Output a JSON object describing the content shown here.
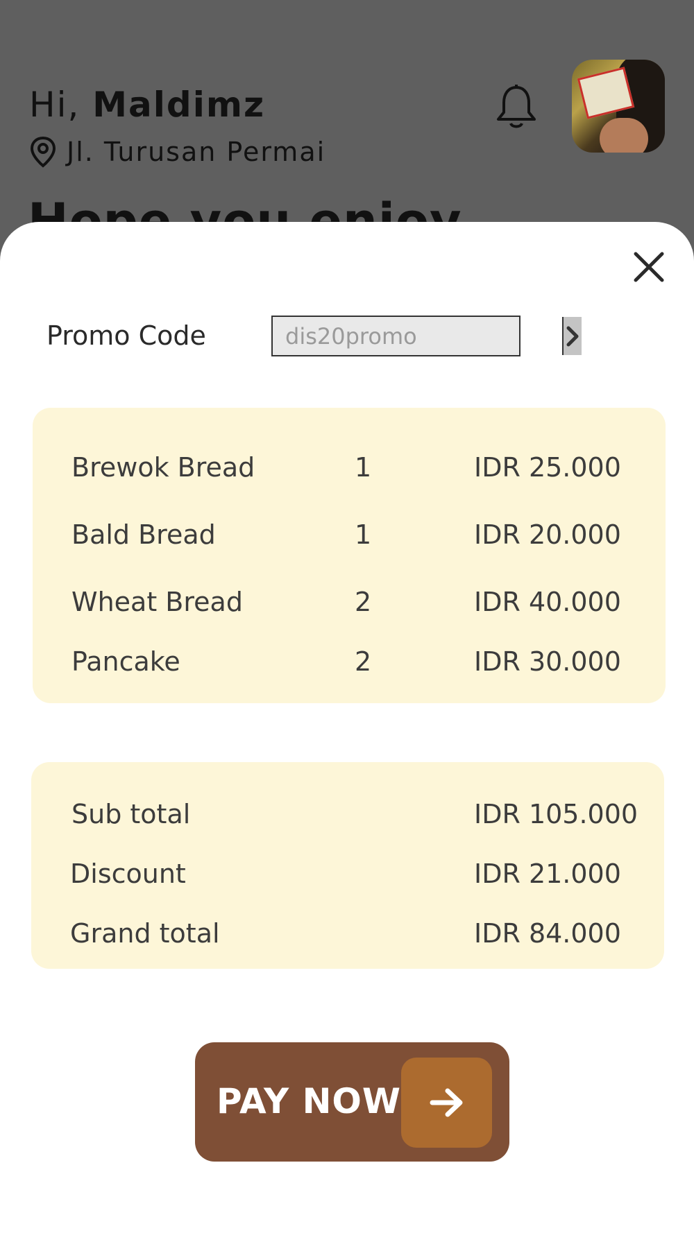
{
  "header": {
    "greeting_prefix": "Hi,",
    "user_name": "Maldimz",
    "location": "Jl. Turusan Permai",
    "headline_partial": "Hope you enjoy"
  },
  "promo": {
    "label": "Promo Code",
    "value": "dis20promo"
  },
  "order_items": [
    {
      "name": "Brewok Bread",
      "qty": "1",
      "price": "IDR 25.000"
    },
    {
      "name": "Bald Bread",
      "qty": "1",
      "price": "IDR 20.000"
    },
    {
      "name": "Wheat Bread",
      "qty": "2",
      "price": "IDR 40.000"
    },
    {
      "name": "Pancake",
      "qty": "2",
      "price": "IDR 30.000"
    }
  ],
  "totals": [
    {
      "label": "Sub total",
      "value": "IDR 105.000"
    },
    {
      "label": "Discount",
      "value": "IDR 21.000"
    },
    {
      "label": "Grand total",
      "value": "IDR 84.000"
    }
  ],
  "pay_button": {
    "label": "PAY NOW"
  },
  "colors": {
    "overlay": "#5f5f5f",
    "panel": "#fdf6d8",
    "pay_button": "#7f4f36",
    "pay_arrow": "#ac6b2f"
  }
}
